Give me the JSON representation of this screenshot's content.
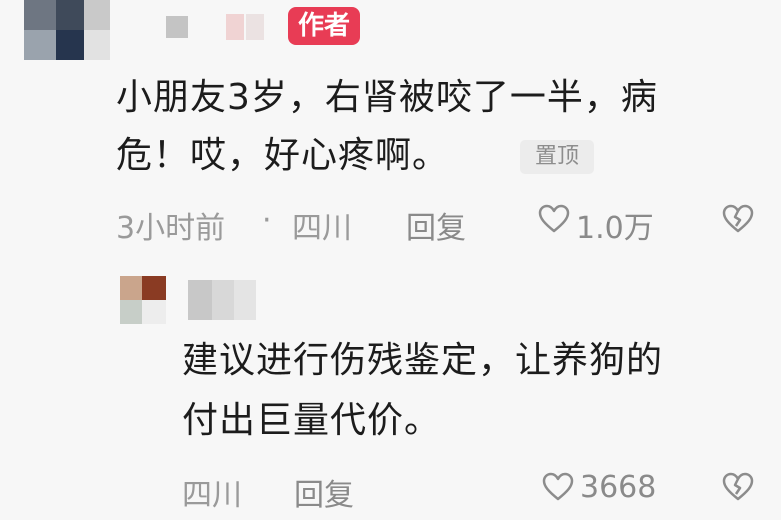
{
  "comment": {
    "author_badge": "作者",
    "text_line1": "小朋友3岁，右肾被咬了一半，病",
    "text_line2": "危！哎，好心疼啊。",
    "pin_badge": "置顶",
    "time": "3小时前",
    "separator": "·",
    "location": "四川",
    "reply_label": "回复",
    "like_count": "1.0万"
  },
  "reply": {
    "text_line1": "建议进行伤残鉴定，让养狗的",
    "text_line2": "付出巨量代价。",
    "location": "四川",
    "reply_label": "回复",
    "like_count": "3668"
  },
  "icons": {
    "like": "heart-outline-icon",
    "dislike": "broken-heart-icon"
  },
  "colors": {
    "background": "#f7f7f7",
    "author_badge_bg": "#e83c55",
    "meta_text": "#9a9a9a",
    "body_text": "#1c1c1c"
  }
}
